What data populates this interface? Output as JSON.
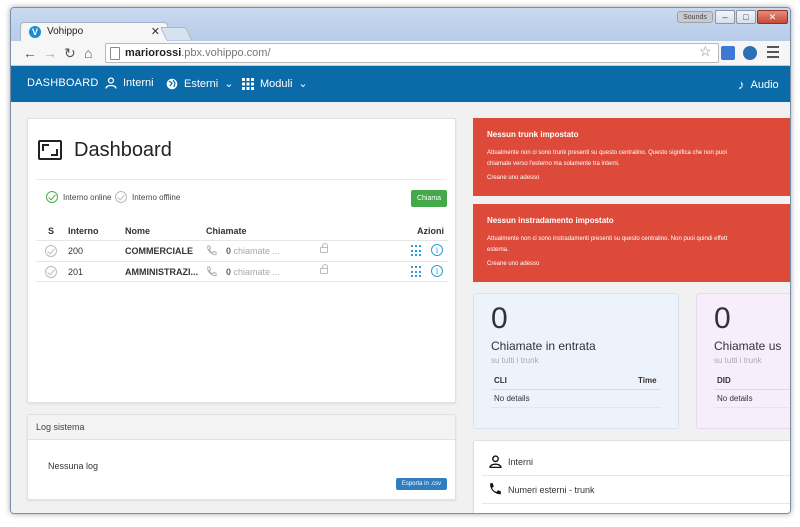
{
  "browser": {
    "tab_title": "Vohippo",
    "tab_favicon_letter": "V",
    "url_host": "mariorossi",
    "url_rest": ".pbx.vohippo.com/",
    "user_chip": "Sounds",
    "accent": "#0b6aa8"
  },
  "nav": {
    "brand": "DASHBOARD",
    "items": [
      {
        "label": "Interni",
        "icon": "user-icon"
      },
      {
        "label": "Esterni",
        "icon": "globe-icon"
      },
      {
        "label": "Moduli",
        "icon": "grid-icon"
      }
    ],
    "audio": "Audio"
  },
  "dashboard": {
    "title": "Dashboard",
    "legend_online": "Interno online",
    "legend_offline": "Interno offline",
    "call_button": "Chiama",
    "columns": [
      "S",
      "Interno",
      "Nome",
      "Chiamate",
      "Azioni"
    ],
    "rows": [
      {
        "interno": "200",
        "nome": "COMMERCIALE",
        "chiamate_count": "0",
        "chiamate_text": "chiamate ..."
      },
      {
        "interno": "201",
        "nome": "AMMINISTRAZI...",
        "chiamate_count": "0",
        "chiamate_text": "chiamate ..."
      }
    ]
  },
  "log": {
    "title": "Log sistema",
    "empty": "Nessuna log",
    "export_button": "Esporta in .csv"
  },
  "alerts": [
    {
      "title": "Nessun trunk impostato",
      "text_line1": "Attualmente non ci sono trunk presenti su questo centralino. Questo significa che non puoi",
      "text_line2": "chiamate verso l'esterno ma solamente tra interni.",
      "cta": "Creane uno adesso",
      "color": "#de4a3a"
    },
    {
      "title": "Nessun instradamento impostato",
      "text_line1": "Attualmente non ci sono instradamenti presenti su questo centralino. Non puoi quindi effett",
      "text_line2": "esterna.",
      "cta": "Creane uno adesso",
      "color": "#de4a3a"
    }
  ],
  "stats": [
    {
      "value": "0",
      "label": "Chiamate in entrata",
      "sub": "su tutti i trunk",
      "col1": "CLI",
      "col2": "Time",
      "empty": "No details",
      "bg": "#edf3fb"
    },
    {
      "value": "0",
      "label": "Chiamate us",
      "sub": "su tutti i trunk",
      "col1": "DID",
      "col2": "",
      "empty": "No details",
      "bg": "#f8eefb"
    }
  ],
  "quicklinks": [
    {
      "label": "Interni",
      "icon": "user-icon"
    },
    {
      "label": "Numeri esterni - trunk",
      "icon": "phone-icon"
    }
  ]
}
